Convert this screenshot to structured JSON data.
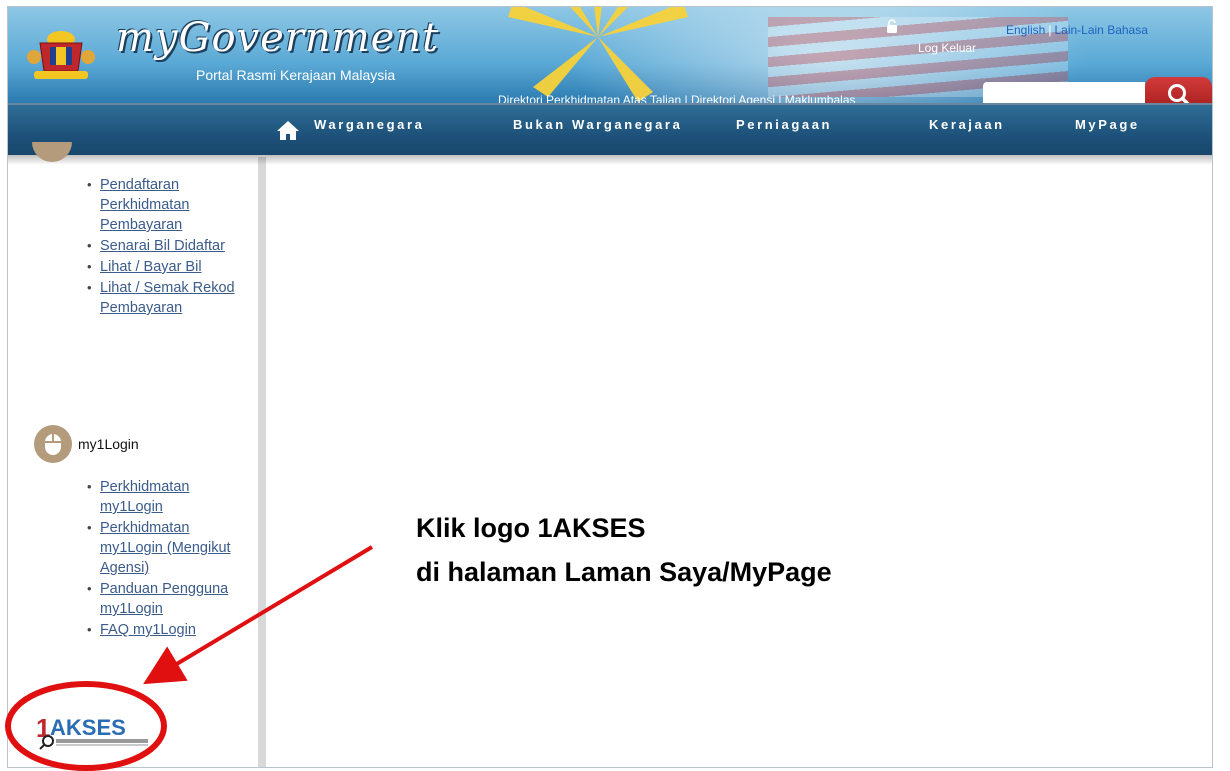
{
  "header": {
    "title": "myGovernment",
    "subtitle": "Portal Rasmi Kerajaan Malaysia",
    "logout_label": "Log Keluar",
    "lang_english": "English",
    "lang_separator": "|",
    "lang_other": "Lain-Lain Bahasa",
    "top_links": "Direktori Perkhidmatan Atas Talian | Direktori Agensi | Maklumbalas",
    "search_value": ""
  },
  "nav": {
    "items": [
      "Warganegara",
      "Bukan Warganegara",
      "Perniagaan",
      "Kerajaan",
      "MyPage"
    ]
  },
  "sidebar": {
    "payment_items": [
      "Pendaftaran Perkhidmatan Pembayaran",
      "Senarai Bil Didaftar",
      "Lihat / Bayar Bil",
      "Lihat / Semak Rekod Pembayaran"
    ],
    "section_label": "my1Login",
    "login_items": [
      "Perkhidmatan my1Login",
      "Perkhidmatan my1Login (Mengikut Agensi)",
      "Panduan Pengguna my1Login",
      "FAQ my1Login"
    ],
    "akses_logo_text": "1AKSES"
  },
  "annotation": {
    "line1": "Klik logo 1AKSES",
    "line2": "di halaman Laman Saya/MyPage"
  },
  "colors": {
    "nav_bg": "#1d5179",
    "link": "#3b5b8a",
    "annotation_red": "#e01010",
    "search_button": "#c0272d"
  }
}
